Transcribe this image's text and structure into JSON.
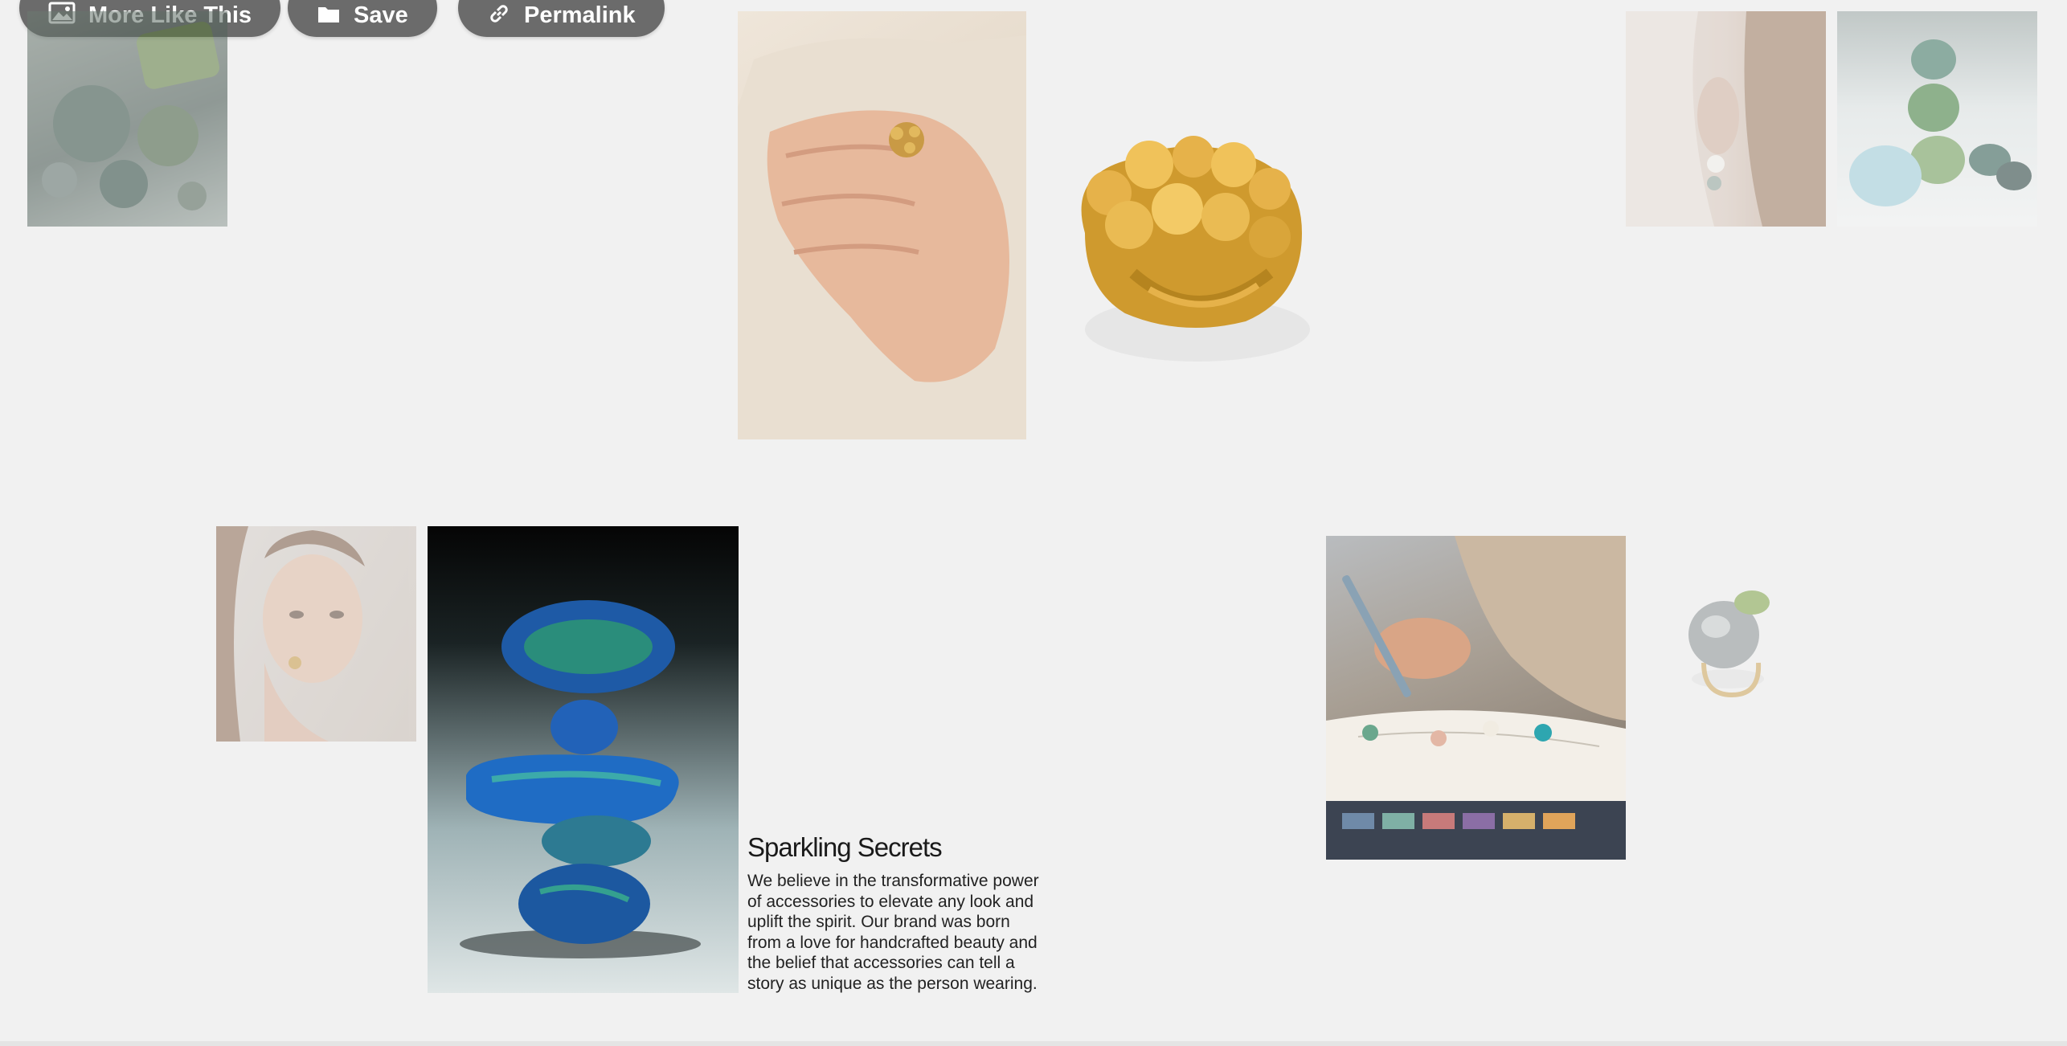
{
  "toolbar": {
    "more_like_this": {
      "label": "More Like This",
      "icon": "image-icon"
    },
    "save": {
      "label": "Save",
      "icon": "folder-icon"
    },
    "permalink": {
      "label": "Permalink",
      "icon": "link-icon"
    }
  },
  "gallery": {
    "items": [
      {
        "name": "green-gemstones-photo",
        "faded": true
      },
      {
        "name": "hand-with-gold-ring-photo",
        "faded": false
      },
      {
        "name": "gold-bubble-ring-photo",
        "faded": false
      },
      {
        "name": "pearl-earring-model-photo",
        "faded": true
      },
      {
        "name": "stacked-cabochons-photo",
        "faded": true
      },
      {
        "name": "woman-portrait-photo",
        "faded": true
      },
      {
        "name": "stacked-opals-photo",
        "faded": false
      },
      {
        "name": "jeweler-sketching-photo",
        "faded": false
      },
      {
        "name": "moonstone-ring-photo",
        "faded": true
      }
    ]
  },
  "article": {
    "title": "Sparkling Secrets",
    "body": "We believe in the transformative power of accessories to elevate any look and uplift the spirit. Our brand was born from a love for handcrafted beauty and the belief that accessories can tell a story as unique as the person wearing."
  },
  "colors": {
    "background": "#f1f1f1",
    "pill": "#6b6b6b",
    "gold": "#d9a53a",
    "opal_blue": "#2a6fb8"
  }
}
